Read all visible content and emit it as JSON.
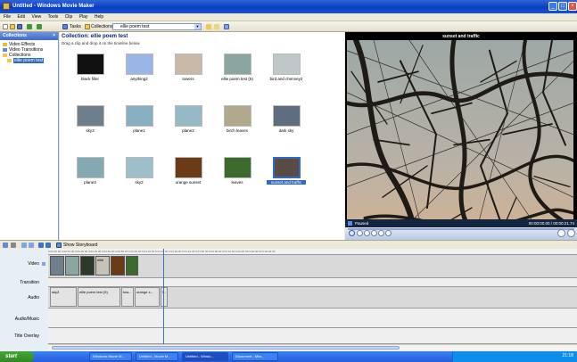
{
  "window": {
    "title": "Untitled - Windows Movie Maker"
  },
  "menu": [
    "File",
    "Edit",
    "View",
    "Tools",
    "Clip",
    "Play",
    "Help"
  ],
  "toolbar": {
    "tasks_label": "Tasks",
    "collections_label": "Collections",
    "collection_value": "ellie poem test"
  },
  "sidebar": {
    "header": "Collections",
    "close_glyph": "×",
    "items": [
      {
        "label": "Video Effects",
        "icon": "star-icon"
      },
      {
        "label": "Video Transitions",
        "icon": "transition-icon"
      },
      {
        "label": "Collections",
        "icon": "folder-icon"
      },
      {
        "label": "ellie poem test",
        "icon": "folder-icon",
        "selected": true
      }
    ]
  },
  "collection": {
    "title": "Collection: ellie poem test",
    "subtitle": "Drag a clip and drop it on the timeline below.",
    "clips": [
      {
        "label": "black filler",
        "color": "#111111"
      },
      {
        "label": "anything2",
        "color": "#9AB6E6"
      },
      {
        "label": "towers",
        "color": "#C9B9A8"
      },
      {
        "label": "ellie poem test (5)",
        "color": "#8BA6A0"
      },
      {
        "label": "bird and chimney2",
        "color": "#BFC7C9"
      },
      {
        "label": "sky3",
        "color": "#6E7E8A"
      },
      {
        "label": "plane1",
        "color": "#89B0C2"
      },
      {
        "label": "plane2",
        "color": "#97B9C6"
      },
      {
        "label": "birch leaves",
        "color": "#B1A98E"
      },
      {
        "label": "dark sky",
        "color": "#5E6E80"
      },
      {
        "label": "plane3",
        "color": "#85A9B3"
      },
      {
        "label": "sky2",
        "color": "#9EBFC9"
      },
      {
        "label": "orange sunset",
        "color": "#6B3A17"
      },
      {
        "label": "leaves",
        "color": "#3C6A2E"
      },
      {
        "label": "sunset and traffic",
        "color": "#594B43",
        "selected": true
      }
    ]
  },
  "monitor": {
    "title": "sunset and traffic",
    "status": "Paused",
    "time": "00:00:00.00 / 00:00:21.74"
  },
  "timeline": {
    "toggle_label": "Show Storyboard",
    "ruler_text": "0:00:00.00   0:00:10.00   0:00:20.00   0:00:30.00   0:00:40.00   0:00:50.00   0:01:00.00   0:01:10.00   0:01:20.00   0:01:30.00   0:01:40.00   0:01:50.00   0:02:00.00   0:02:10.00   0:02:20.00   0:02:30.00   0:02:40.00",
    "tracks": {
      "video": "Video",
      "transition": "Transition",
      "audio": "Audio",
      "audio_music": "Audio/Music",
      "title_overlay": "Title Overlay"
    },
    "video_clips": [
      {
        "color": "#6F7F8B"
      },
      {
        "color": "#8BA6A0"
      },
      {
        "color": "#2D3A2A"
      },
      {
        "color": "#C5C3B5",
        "label": "ellie"
      },
      {
        "color": "#6B3A17"
      },
      {
        "color": "#3C6A2E"
      }
    ],
    "audio_clips": [
      {
        "label": "sky3"
      },
      {
        "label": "ellie poem test (5)"
      },
      {
        "label": "tow..."
      },
      {
        "label": "orange s..."
      },
      {
        "label": "l..."
      }
    ]
  },
  "taskbar": {
    "start": "start",
    "tasks": [
      {
        "label": "Windows Movie M..."
      },
      {
        "label": "Untitled - Movie M..."
      },
      {
        "label": "Untitled - Windo..."
      },
      {
        "label": "Document - Micr..."
      }
    ],
    "clock": "21:18"
  }
}
